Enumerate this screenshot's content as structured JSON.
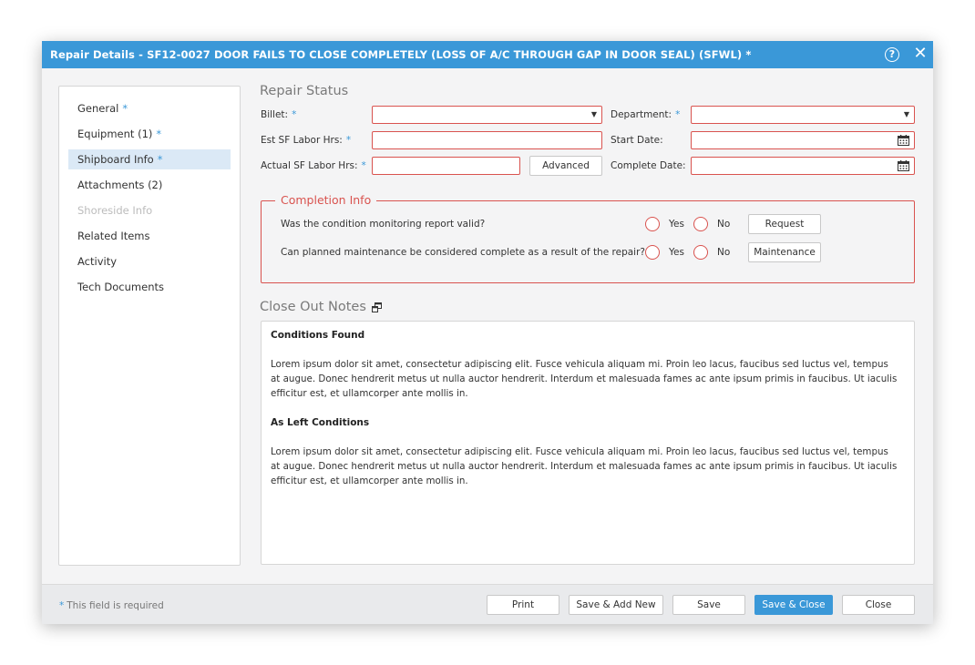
{
  "dialog": {
    "title": "Repair Details - SF12-0027 DOOR FAILS TO CLOSE COMPLETELY (LOSS OF A/C THROUGH GAP IN DOOR SEAL) (SFWL) *",
    "help_icon": "question-circle-icon",
    "close_icon": "close-x-icon",
    "help_glyph": "?",
    "close_glyph": "✕"
  },
  "sidebar": {
    "items": [
      {
        "label": "General",
        "required": "*"
      },
      {
        "label": "Equipment (1)",
        "required": "*"
      },
      {
        "label": "Shipboard Info",
        "required": "*"
      },
      {
        "label": "Attachments (2)",
        "required": ""
      },
      {
        "label": "Shoreside Info",
        "required": ""
      },
      {
        "label": "Related Items",
        "required": ""
      },
      {
        "label": "Activity",
        "required": ""
      },
      {
        "label": "Tech Documents",
        "required": ""
      }
    ],
    "selected": "Shipboard Info",
    "disabled": "Shoreside Info"
  },
  "repair_status": {
    "title": "Repair Status",
    "billet_label": "Billet:",
    "billet_req": "*",
    "billet_value": "",
    "department_label": "Department:",
    "department_req": "*",
    "department_value": "",
    "est_label": "Est SF Labor Hrs:",
    "est_req": "*",
    "est_value": "",
    "start_label": "Start Date:",
    "start_value": "",
    "actual_label": "Actual SF Labor Hrs:",
    "actual_req": "*",
    "actual_value": "",
    "advanced_button": "Advanced",
    "complete_label": "Complete Date:",
    "complete_value": "",
    "select_arrow": "▼",
    "calendar_icon": "calendar-icon"
  },
  "completion_info": {
    "title": "Completion Info",
    "q1": "Was the condition monitoring report valid?",
    "q2": "Can planned maintenance be considered complete as a result of the repair?",
    "yes": "Yes",
    "no": "No",
    "request_button": "Request",
    "maintenance_button": "Maintenance"
  },
  "close_out_notes": {
    "title": "Close Out Notes",
    "expand_icon": "popout-window-icon",
    "h1": "Conditions Found",
    "p1": "Lorem ipsum dolor sit amet, consectetur adipiscing elit. Fusce vehicula aliquam mi. Proin leo lacus, faucibus sed luctus vel, tempus at augue. Donec hendrerit metus ut nulla auctor hendrerit. Interdum et malesuada fames ac ante ipsum primis in faucibus. Ut iaculis efficitur est, et ullamcorper ante mollis in.",
    "h2": "As Left Conditions",
    "p2": "Lorem ipsum dolor sit amet, consectetur adipiscing elit. Fusce vehicula aliquam mi. Proin leo lacus, faucibus sed luctus vel, tempus at augue. Donec hendrerit metus ut nulla auctor hendrerit. Interdum et malesuada fames ac ante ipsum primis in faucibus. Ut iaculis efficitur est, et ullamcorper ante mollis in."
  },
  "footer": {
    "required_star": "*",
    "required_note": "This field is required",
    "print": "Print",
    "save_add_new": "Save & Add New",
    "save": "Save",
    "save_close": "Save & Close",
    "close": "Close"
  },
  "colors": {
    "accent": "#3a98d8",
    "error": "#d9534f",
    "selected_bg": "#dbe9f6"
  }
}
